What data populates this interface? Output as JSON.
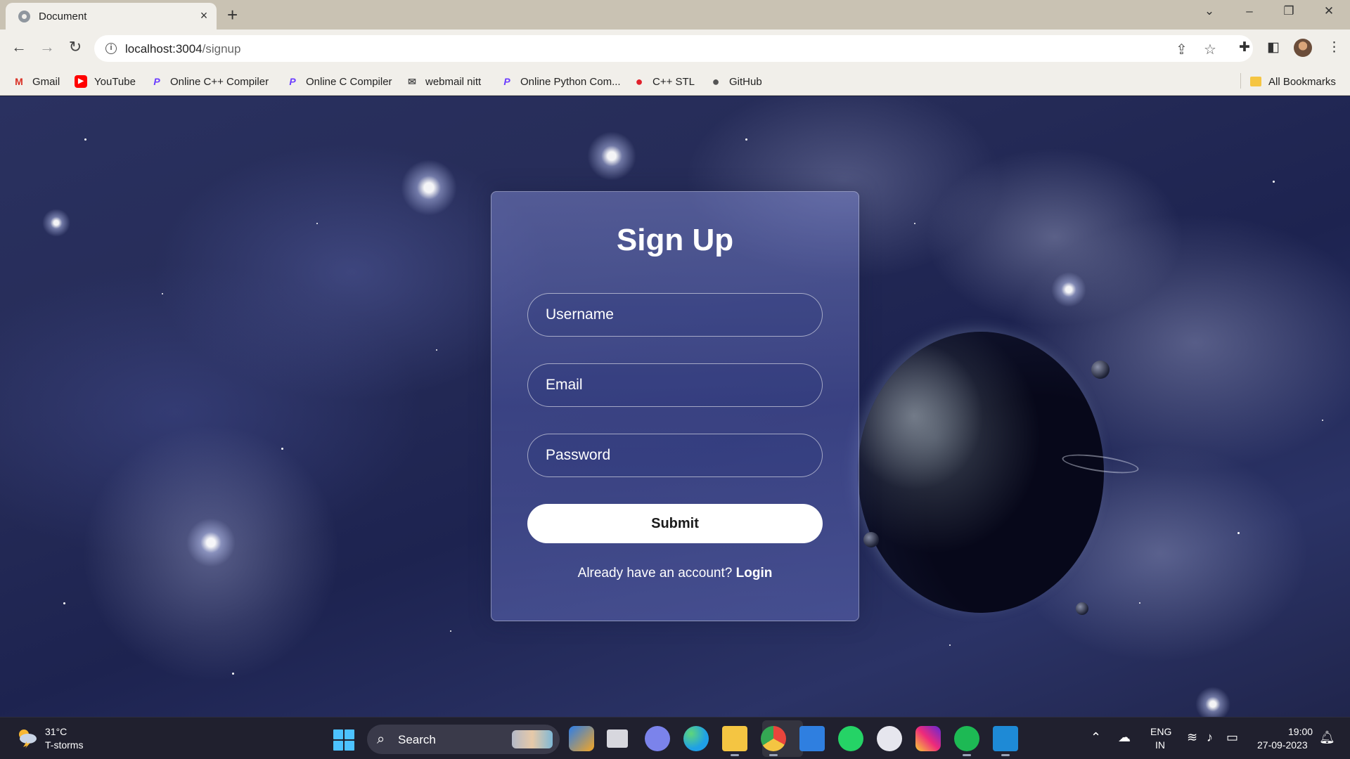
{
  "browser": {
    "tab_title": "Document",
    "tab_close": "×",
    "new_tab": "+",
    "url_host": "localhost:3004",
    "url_path": "/signup",
    "window_controls": {
      "dropdown": "⌄",
      "minimize": "–",
      "restore": "❐",
      "close": "✕"
    }
  },
  "bookmarks": [
    {
      "label": "Gmail",
      "icon": "gmail-icon",
      "color": "#d93025",
      "glyph": "M"
    },
    {
      "label": "YouTube",
      "icon": "youtube-icon",
      "color": "#ff0000",
      "glyph": "▶"
    },
    {
      "label": "Online C++ Compiler",
      "icon": "programiz-icon",
      "color": "#6b3cff",
      "glyph": "P"
    },
    {
      "label": "Online C Compiler",
      "icon": "programiz-icon",
      "color": "#6b3cff",
      "glyph": "P"
    },
    {
      "label": "webmail nitt",
      "icon": "webmail-icon",
      "color": "#555555",
      "glyph": "✉"
    },
    {
      "label": "Online Python Com...",
      "icon": "programiz-icon",
      "color": "#6b3cff",
      "glyph": "P"
    },
    {
      "label": "C++ STL",
      "icon": "tuf-icon",
      "color": "#e0202b",
      "glyph": "●"
    },
    {
      "label": "GitHub",
      "icon": "github-icon",
      "color": "#555555",
      "glyph": "●"
    }
  ],
  "all_bookmarks": "All Bookmarks",
  "signup": {
    "title": "Sign Up",
    "username_placeholder": "Username",
    "email_placeholder": "Email",
    "password_placeholder": "Password",
    "submit_label": "Submit",
    "account_prompt": "Already have an account?",
    "login_link": "Login"
  },
  "taskbar": {
    "temperature": "31°C",
    "weather": "T-storms",
    "search_label": "Search",
    "language": "ENG",
    "region": "IN",
    "time": "19:00",
    "date": "27-09-2023",
    "apps": [
      {
        "name": "copilot-icon",
        "color": "#2b7de9"
      },
      {
        "name": "task-view-icon",
        "color": "#d7d7de"
      },
      {
        "name": "teams-chat-icon",
        "color": "#7b83eb"
      },
      {
        "name": "edge-icon",
        "color": "#1fa0e6"
      },
      {
        "name": "file-explorer-icon",
        "color": "#f4c542"
      },
      {
        "name": "chrome-icon",
        "color": "#e9453c"
      },
      {
        "name": "mail-icon",
        "color": "#2f7fe0"
      },
      {
        "name": "whatsapp-icon",
        "color": "#25d366"
      },
      {
        "name": "messenger-icon",
        "color": "#e6e6ee"
      },
      {
        "name": "instagram-icon",
        "color": "#d6306f"
      },
      {
        "name": "spotify-icon",
        "color": "#1db954"
      },
      {
        "name": "vscode-icon",
        "color": "#1e8ad6"
      }
    ]
  }
}
